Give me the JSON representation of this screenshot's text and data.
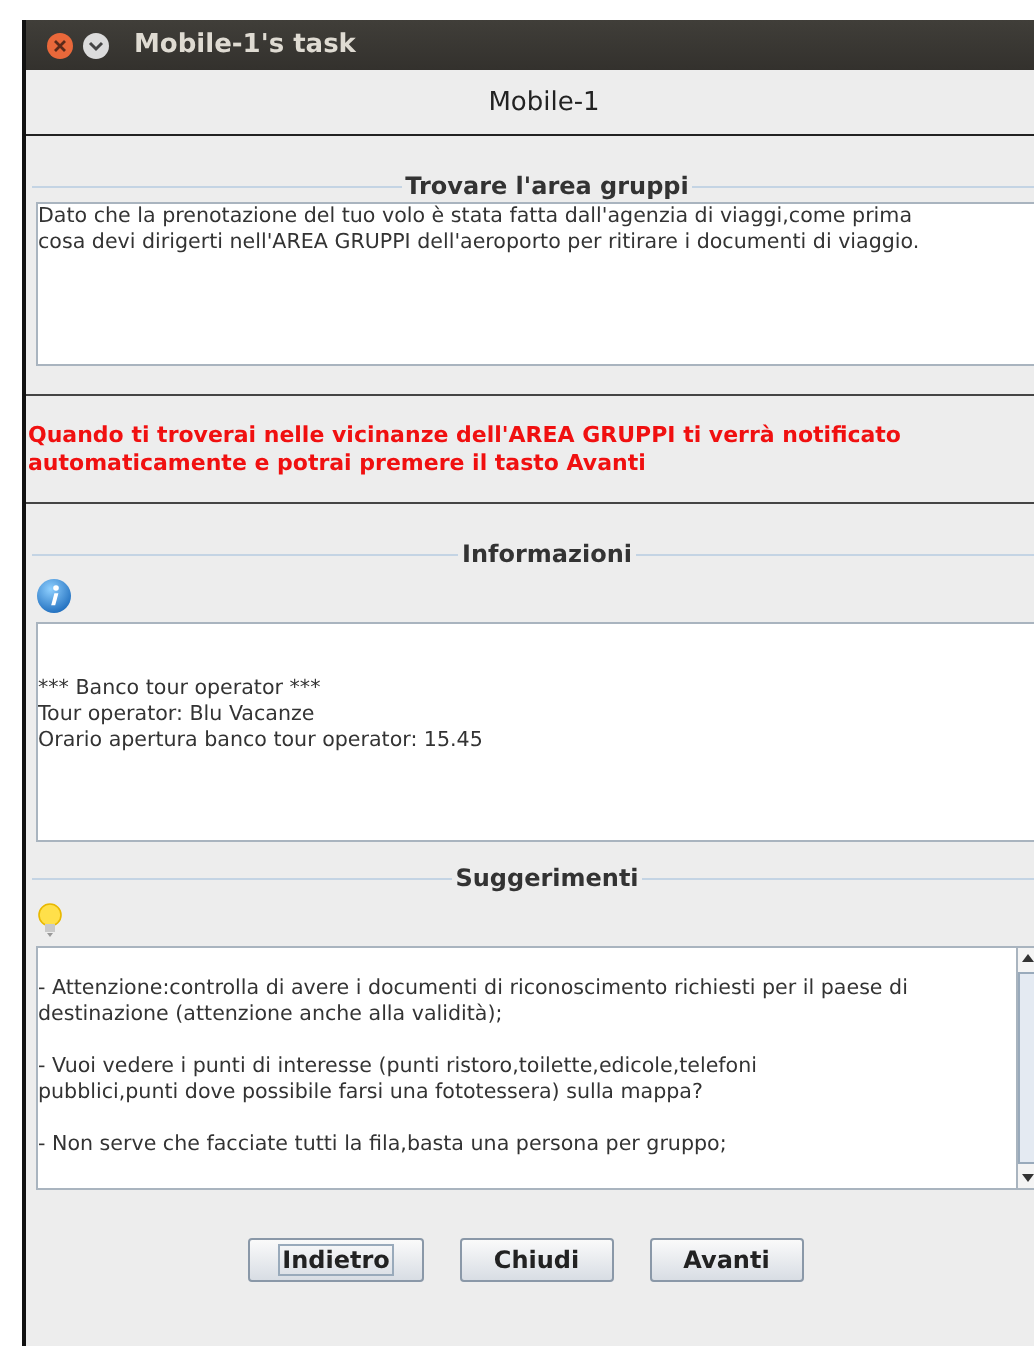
{
  "window": {
    "title": "Mobile-1's task"
  },
  "header": {
    "title": "Mobile-1"
  },
  "task": {
    "title": "Trovare l'area gruppi",
    "lines": [
      "Dato che la prenotazione del tuo volo è stata fatta dall'agenzia di viaggi,come prima",
      "cosa devi dirigerti nell'AREA GRUPPI dell'aeroporto per ritirare i documenti di viaggio."
    ]
  },
  "notice": "Quando ti troverai nelle vicinanze dell'AREA GRUPPI ti verrà notificato automaticamente e potrai premere il tasto Avanti",
  "info": {
    "title": "Informazioni",
    "lines": [
      "*** Banco tour operator ***",
      "Tour operator: Blu Vacanze",
      "Orario apertura banco tour operator: 15.45"
    ]
  },
  "tips": {
    "title": "Suggerimenti",
    "paragraphs": [
      [
        "- Attenzione:controlla di avere i documenti di riconoscimento richiesti per il paese di",
        "destinazione (attenzione anche alla validità);"
      ],
      [
        "- Vuoi vedere i punti di interesse (punti ristoro,toilette,edicole,telefoni",
        "pubblici,punti dove possibile farsi una fototessera) sulla mappa?"
      ],
      [
        "- Non serve che facciate tutti la fila,basta una persona per gruppo;"
      ]
    ]
  },
  "buttons": [
    {
      "label": "Indietro",
      "focused": true
    },
    {
      "label": "Chiudi",
      "focused": false
    },
    {
      "label": "Avanti",
      "focused": false
    }
  ]
}
